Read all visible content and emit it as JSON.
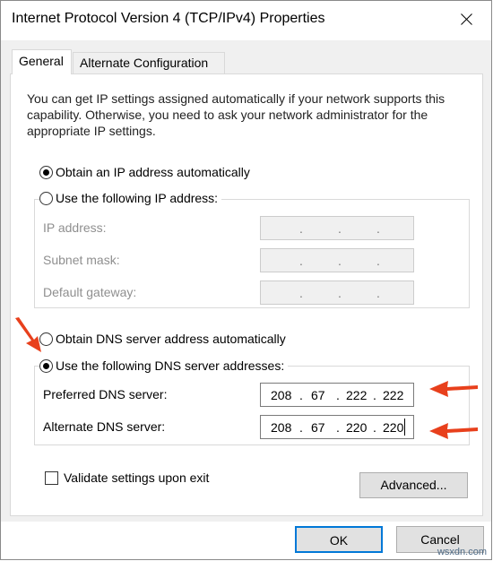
{
  "window": {
    "title": "Internet Protocol Version 4 (TCP/IPv4) Properties"
  },
  "tabs": [
    {
      "label": "General"
    },
    {
      "label": "Alternate Configuration"
    }
  ],
  "description": "You can get IP settings assigned automatically if your network supports this capability. Otherwise, you need to ask your network administrator for the appropriate IP settings.",
  "ip": {
    "auto_label": "Obtain an IP address automatically",
    "manual_label": "Use the following IP address:",
    "fields": [
      {
        "label": "IP address:",
        "value": ""
      },
      {
        "label": "Subnet mask:",
        "value": ""
      },
      {
        "label": "Default gateway:",
        "value": ""
      }
    ]
  },
  "dns": {
    "auto_label": "Obtain DNS server address automatically",
    "manual_label": "Use the following DNS server addresses:",
    "preferred": {
      "label": "Preferred DNS server:",
      "octets": [
        "208",
        "67",
        "222",
        "222"
      ]
    },
    "alternate": {
      "label": "Alternate DNS server:",
      "octets": [
        "208",
        "67",
        "220",
        "220"
      ]
    }
  },
  "validate_label": "Validate settings upon exit",
  "buttons": {
    "advanced": "Advanced...",
    "ok": "OK",
    "cancel": "Cancel"
  },
  "colors": {
    "arrow": "#e8401c",
    "accent": "#0078d7"
  },
  "watermark": "wsxdn.com"
}
